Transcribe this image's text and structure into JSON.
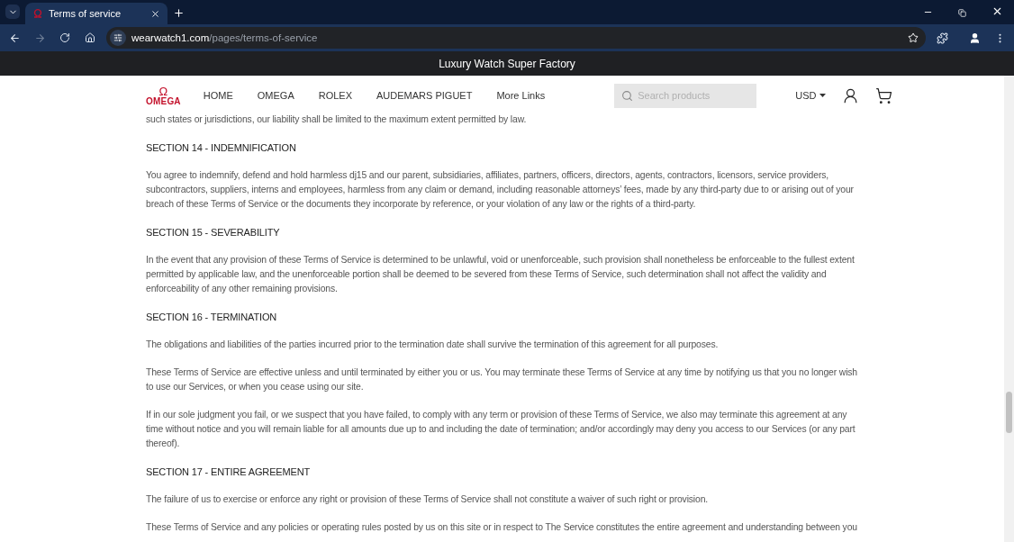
{
  "browser": {
    "tabs": [
      {
        "title": "Terms of service",
        "selected": true
      }
    ],
    "address": {
      "domain": "wearwatch1.com",
      "path": "/pages/terms-of-service"
    }
  },
  "announcement": "Luxury Watch Super Factory",
  "header": {
    "logo": {
      "symbol": "Ω",
      "text": "OMEGA"
    },
    "nav": [
      "HOME",
      "OMEGA",
      "ROLEX",
      "AUDEMARS PIGUET",
      "More Links"
    ],
    "search": {
      "placeholder": "Search products"
    },
    "currency": "USD"
  },
  "content": [
    {
      "kind": "paragraph",
      "text": "such states or jurisdictions, our liability shall be limited to the maximum extent permitted by law."
    },
    {
      "kind": "heading",
      "text": "SECTION 14 - INDEMNIFICATION"
    },
    {
      "kind": "paragraph",
      "text": "You agree to indemnify, defend and hold harmless dj15 and our parent, subsidiaries, affiliates, partners, officers, directors, agents, contractors, licensors, service providers, subcontractors, suppliers, interns and employees, harmless from any claim or demand, including reasonable attorneys’ fees, made by any third-party due to or arising out of your breach of these Terms of Service or the documents they incorporate by reference, or your violation of any law or the rights of a third-party."
    },
    {
      "kind": "heading",
      "text": "SECTION 15 - SEVERABILITY"
    },
    {
      "kind": "paragraph",
      "text": "In the event that any provision of these Terms of Service is determined to be unlawful, void or unenforceable, such provision shall nonetheless be enforceable to the fullest extent permitted by applicable law, and the unenforceable portion shall be deemed to be severed from these Terms of Service, such determination shall not affect the validity and enforceability of any other remaining provisions."
    },
    {
      "kind": "heading",
      "text": "SECTION 16 - TERMINATION"
    },
    {
      "kind": "paragraph",
      "text": "The obligations and liabilities of the parties incurred prior to the termination date shall survive the termination of this agreement for all purposes."
    },
    {
      "kind": "paragraph",
      "text": "These Terms of Service are effective unless and until terminated by either you or us. You may terminate these Terms of Service at any time by notifying us that you no longer wish to use our Services, or when you cease using our site."
    },
    {
      "kind": "paragraph",
      "text": "If in our sole judgment you fail, or we suspect that you have failed, to comply with any term or provision of these Terms of Service, we also may terminate this agreement at any time without notice and you will remain liable for all amounts due up to and including the date of termination; and/or accordingly may deny you access to our Services (or any part thereof)."
    },
    {
      "kind": "heading",
      "text": "SECTION 17 - ENTIRE AGREEMENT"
    },
    {
      "kind": "paragraph",
      "text": "The failure of us to exercise or enforce any right or provision of these Terms of Service shall not constitute a waiver of such right or provision."
    },
    {
      "kind": "paragraph",
      "text": "These Terms of Service and any policies or operating rules posted by us on this site or in respect to The Service constitutes the entire agreement and understanding between you"
    }
  ]
}
